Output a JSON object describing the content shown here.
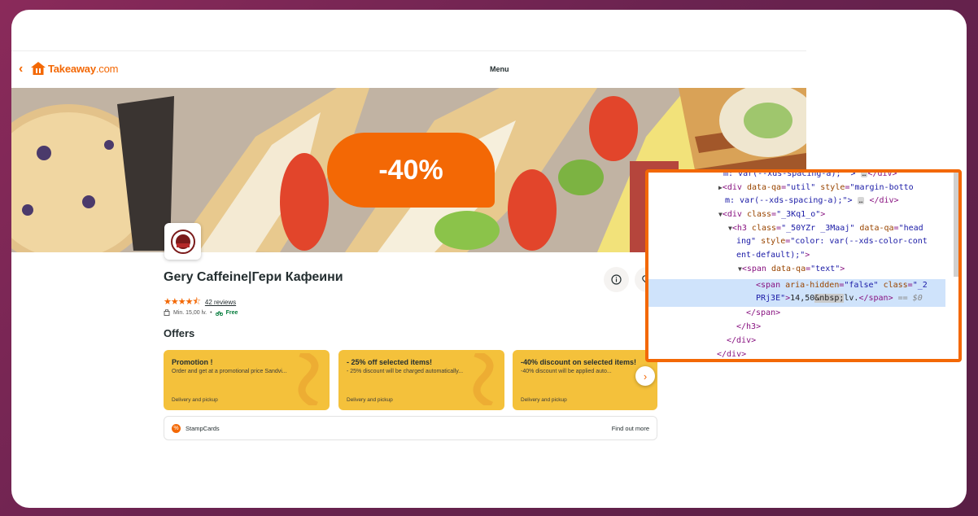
{
  "header": {
    "back_label": "‹",
    "brand_main": "Takeaway",
    "brand_suffix": ".com",
    "menu_label": "Menu"
  },
  "banner": {
    "promo": "-40%"
  },
  "restaurant": {
    "name": "Gery Caffeine|Гери Кафеини",
    "stars": "★★★★⯪",
    "rating": 4.5,
    "reviews": "42 reviews",
    "min_order": "Min. 15,00 lv.",
    "separator": "•",
    "delivery": "Free"
  },
  "offers": {
    "heading": "Offers",
    "items": [
      {
        "title": "Promotion !",
        "text": "Order and get at a promotional price Sandvi...",
        "foot": "Delivery and pickup"
      },
      {
        "title": "- 25% off selected items!",
        "text": "- 25% discount will be charged automatically...",
        "foot": "Delivery and pickup"
      },
      {
        "title": "-40% discount on selected items!",
        "text": "-40% discount will be applied auto...",
        "foot": "Delivery and pickup"
      }
    ],
    "next_label": "›"
  },
  "stampcards": {
    "label": "StampCards",
    "link": "Find out more"
  },
  "devtools": {
    "l1": "m: var(--xds-spacing-a); \">",
    "l1_end": "</div>",
    "l2a": "<div ",
    "l2_attr": "data-qa",
    "l2_val": "\"util\"",
    "l2_attr2": " style",
    "l2_val2": "\"margin-botto",
    "l3": "m: var(--xds-spacing-a);\">",
    "l3_end": "</div>",
    "l4a": "<div ",
    "l4_attr": "class",
    "l4_val": "\"_3Kq1_o\"",
    "l4_end": ">",
    "l5a": "<h3 ",
    "l5_attr": "class",
    "l5_val": "\"_50YZr _3Maaj\"",
    "l5_attr2": " data-qa",
    "l5_val2": "\"head",
    "l6": "ing\"",
    "l6_attr": " style",
    "l6_val": "\"color: var(--xds-color-cont",
    "l7": "ent-default);\"",
    "l7_end": ">",
    "l8a": "<span ",
    "l8_attr": "data-qa",
    "l8_val": "\"text\"",
    "l8_end": ">",
    "l9a": "<span ",
    "l9_attr": "aria-hidden",
    "l9_val": "\"false\"",
    "l9_attr2": " class",
    "l9_val2": "\"_2",
    "l10a": "PRj3E\"",
    "l10b": ">",
    "l10_text": "14,50",
    "l10_ent": "&nbsp;",
    "l10_text2": "lv.",
    "l10_close": "</span>",
    "l10_dim": " == $0",
    "l11": "</span>",
    "l12": "</h3>",
    "l13": "</div>",
    "l14": "</div>",
    "ellipsis": "…",
    "eq": "="
  },
  "colors": {
    "brand": "#f36805",
    "offer_bg": "#f4c13b",
    "selection": "#cfe3fb"
  },
  "icons": [
    "chevron-left-icon",
    "takeaway-house-icon",
    "info-icon",
    "heart-icon",
    "star-icon",
    "bag-icon",
    "bike-icon",
    "chevron-right-icon",
    "stamp-icon"
  ]
}
